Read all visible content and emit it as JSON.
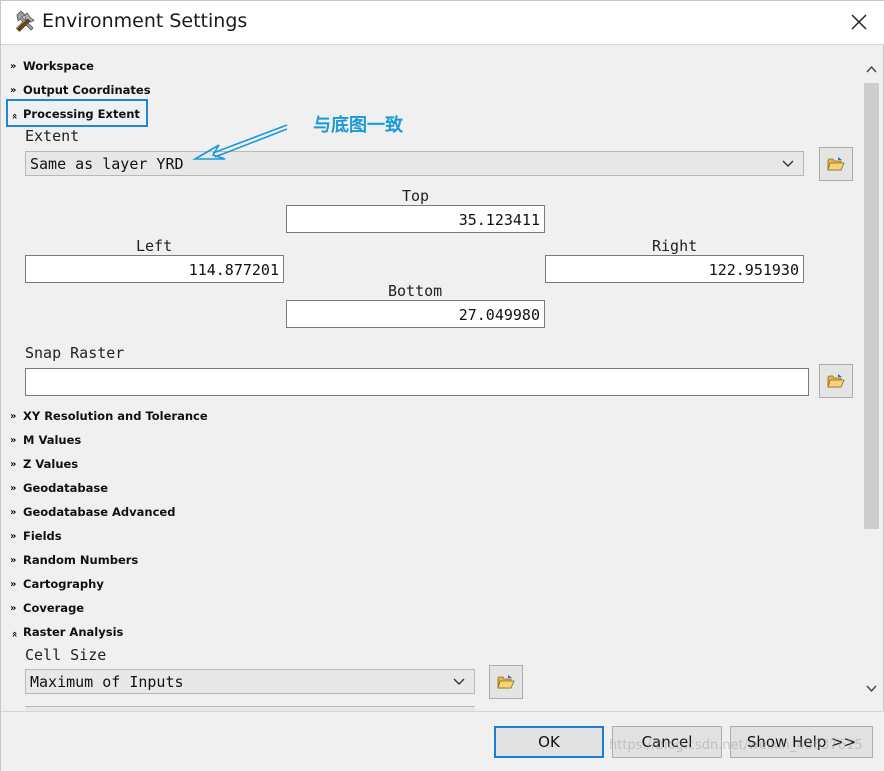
{
  "window": {
    "title": "Environment Settings",
    "icons": {
      "app": "tools-icon",
      "close": "close-icon"
    }
  },
  "sections": {
    "workspace": "Workspace",
    "output_coordinates": "Output Coordinates",
    "processing_extent": "Processing Extent",
    "xy_resolution": "XY Resolution and Tolerance",
    "m_values": "M Values",
    "z_values": "Z Values",
    "geodatabase": "Geodatabase",
    "geodatabase_advanced": "Geodatabase Advanced",
    "fields": "Fields",
    "random_numbers": "Random Numbers",
    "cartography": "Cartography",
    "coverage": "Coverage",
    "raster_analysis": "Raster Analysis"
  },
  "processing_extent": {
    "extent_label": "Extent",
    "extent_value": "Same as layer YRD",
    "top_label": "Top",
    "top_value": "35.123411",
    "left_label": "Left",
    "left_value": "114.877201",
    "right_label": "Right",
    "right_value": "122.951930",
    "bottom_label": "Bottom",
    "bottom_value": "27.049980",
    "snap_raster_label": "Snap Raster",
    "snap_raster_value": ""
  },
  "raster_analysis": {
    "cell_size_label": "Cell Size",
    "cell_size_value": "Maximum of Inputs"
  },
  "annotation": {
    "text": "与底图一致",
    "color": "#1a9ad8"
  },
  "footer": {
    "ok": "OK",
    "cancel": "Cancel",
    "show_help": "Show Help >>",
    "watermark": "https://blog.csdn.net/weixin_45637615"
  },
  "colors": {
    "focus_border": "#1e88d6",
    "ok_border": "#1a7fd4"
  }
}
